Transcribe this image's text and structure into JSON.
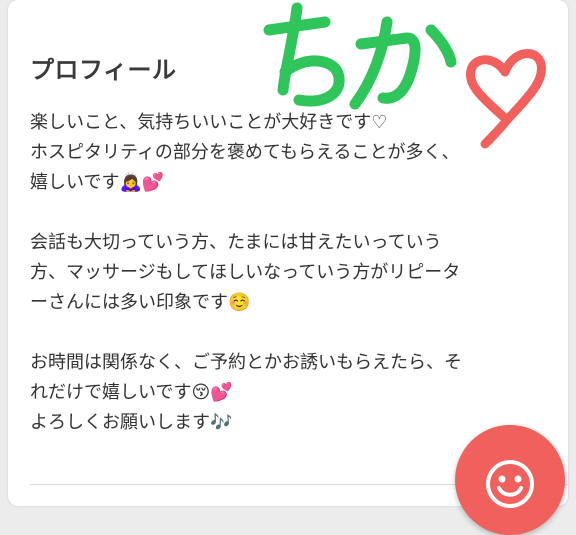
{
  "profile": {
    "heading": "プロフィール",
    "lines": [
      "楽しいこと、気持ちいいことが大好きです♡",
      "ホスピタリティの部分を褒めてもらえることが多く、",
      "嬉しいです🙇‍♀️💕",
      "",
      "会話も大切っていう方、たまには甘えたいっていう",
      "方、マッサージもしてほしいなっていう方がリピータ",
      "ーさんには多い印象です☺️",
      "",
      "お時間は関係なく、ご予約とかお誘いもらえたら、そ",
      "れだけで嬉しいです😚💕",
      "よろしくお願いします🎶"
    ]
  },
  "handwritten_name": "ちか",
  "colors": {
    "handwriting_green": "#2fc55a",
    "heart_red": "#f2605d",
    "fab_red": "#f0605c",
    "text": "#333333"
  },
  "icons": {
    "fab": "smiley-icon",
    "decoration": "heart-icon"
  }
}
